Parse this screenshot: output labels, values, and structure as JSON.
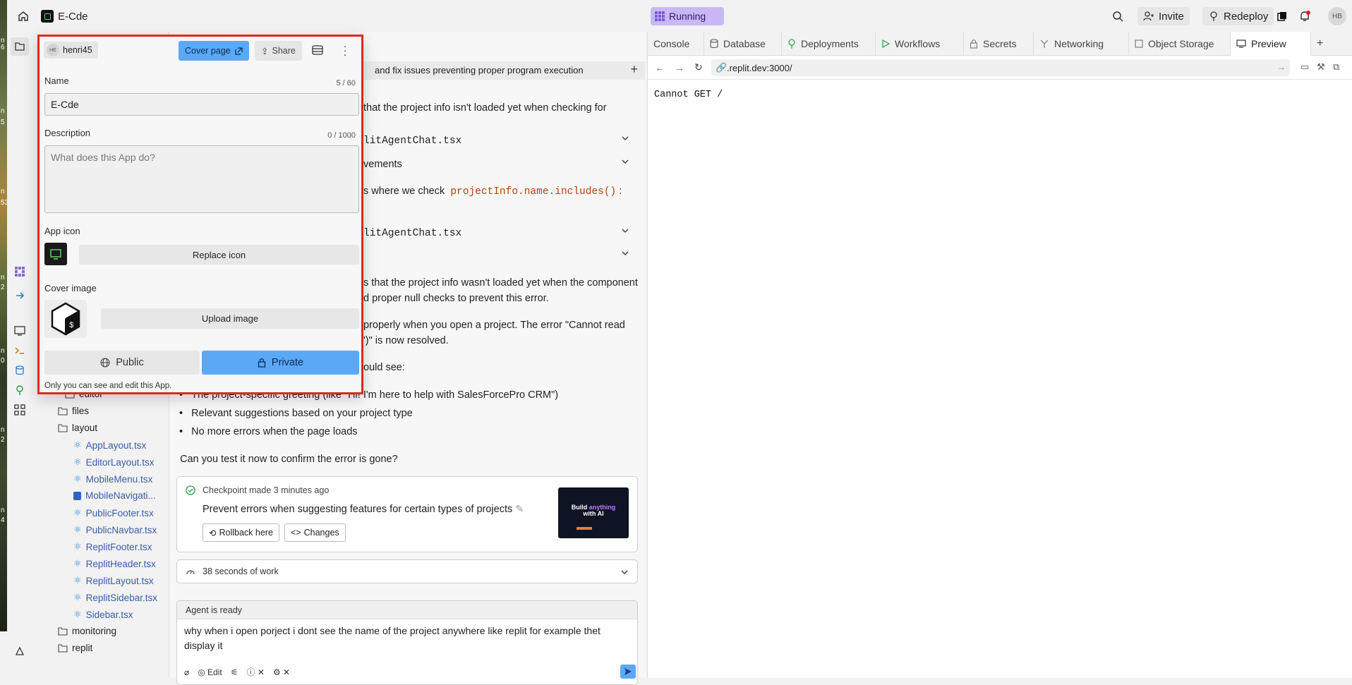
{
  "desktop_fragments": [
    "n",
    "6",
    "n",
    "5",
    "n",
    "53",
    "n",
    "2",
    "n",
    "0",
    "n",
    "2",
    "n",
    "4"
  ],
  "topbar": {
    "project_name": "E-Cde",
    "status": "Running",
    "invite": "Invite",
    "redeploy": "Redeploy",
    "avatar_initials": "HB"
  },
  "file_tree": {
    "folders": [
      "editor",
      "files",
      "layout",
      "monitoring",
      "replit"
    ],
    "layout_files": [
      "AppLayout.tsx",
      "EditorLayout.tsx",
      "MobileMenu.tsx",
      "MobileNavigati...",
      "PublicFooter.tsx",
      "PublicNavbar.tsx",
      "ReplitFooter.tsx",
      "ReplitHeader.tsx",
      "ReplitLayout.tsx",
      "ReplitSidebar.tsx",
      "Sidebar.tsx"
    ]
  },
  "chat": {
    "tab_title": "and fix issues preventing proper program execution",
    "lines": [
      "that the project info isn't loaded yet when checking for",
      "litAgentChat.tsx",
      "vements",
      "s where we check",
      "litAgentChat.tsx",
      "s that the project info wasn't loaded yet when the component",
      "d proper null checks to prevent this error.",
      "properly when you open a project. The error \"Cannot read",
      "')\" is now resolved.",
      "ould see:"
    ],
    "code_snippet": "projectInfo.name.includes()",
    "code_suffix": " :",
    "bullets": [
      "The project-specific greeting (like \"Hi! I'm here to help with SalesForcePro CRM\")",
      "Relevant suggestions based on your project type",
      "No more errors when the page loads"
    ],
    "question": "Can you test it now to confirm the error is gone?",
    "checkpoint": {
      "label": "Checkpoint made",
      "time": "3 minutes ago",
      "title": "Prevent errors when suggesting features for certain types of projects",
      "rollback": "Rollback here",
      "changes": "Changes",
      "thumb_line1": "Build",
      "thumb_highlight": "anything",
      "thumb_line2": "with AI"
    },
    "work_summary": "38 seconds of work",
    "agent_status": "Agent is ready",
    "input_text": "why when i open porject i dont see the name of the project anywhere like replit for example thet display it",
    "edit_label": "Edit"
  },
  "right_panel": {
    "tabs": [
      "Console",
      "Database",
      "Deployments",
      "Workflows",
      "Secrets",
      "Networking",
      "Object Storage",
      "Preview"
    ],
    "url": ".replit.dev:3000/",
    "preview_text": "Cannot GET /"
  },
  "popup": {
    "user_initials": "HE",
    "username": "henri45",
    "cover_page_label": "Cover page",
    "share_label": "Share",
    "name_label": "Name",
    "name_count": "5 / 60",
    "name_value": "E-Cde",
    "description_label": "Description",
    "description_count": "0 / 1000",
    "description_placeholder": "What does this App do?",
    "app_icon_label": "App icon",
    "replace_icon_label": "Replace icon",
    "cover_image_label": "Cover image",
    "upload_image_label": "Upload image",
    "public_label": "Public",
    "private_label": "Private",
    "visibility_note": "Only you can see and edit this App."
  },
  "colors": {
    "highlight_border": "#e02a1c",
    "accent_blue": "#5aa8f6",
    "running_bg": "#c8b8f3"
  }
}
